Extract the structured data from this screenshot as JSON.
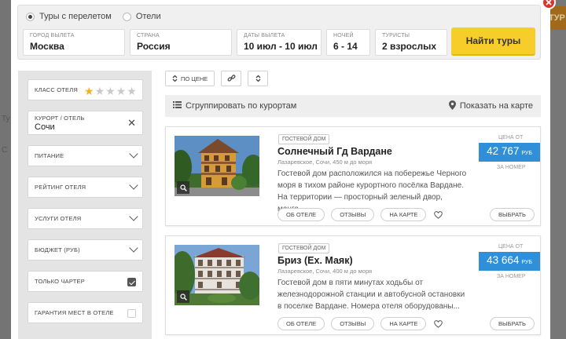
{
  "background": {
    "orange_tab": "ТУР",
    "left_glyphs": [
      "Ту",
      "С"
    ]
  },
  "search": {
    "tour_types": [
      {
        "label": "Туры с перелетом",
        "checked": true
      },
      {
        "label": "Отели",
        "checked": false
      }
    ],
    "fields": [
      {
        "label": "ГОРОД ВЫЛЕТА",
        "value": "Москва"
      },
      {
        "label": "СТРАНА",
        "value": "Россия"
      },
      {
        "label": "ДАТЫ ВЫЛЕТА",
        "value": "10 июл - 10 июл"
      },
      {
        "label": "НОЧЕЙ",
        "value": "6 - 14"
      },
      {
        "label": "ТУРИСТЫ",
        "value": "2 взрослых"
      }
    ],
    "find_button": "Найти туры"
  },
  "filters": {
    "hotel_class": {
      "label": "КЛАСС ОТЕЛЯ",
      "stars_selected": 1,
      "stars_total": 5
    },
    "resort": {
      "label": "КУРОРТ / ОТЕЛЬ",
      "value": "Сочи"
    },
    "dropdowns": [
      {
        "label": "ПИТАНИЕ"
      },
      {
        "label": "РЕЙТИНГ ОТЕЛЯ"
      },
      {
        "label": "УСЛУГИ ОТЕЛЯ"
      },
      {
        "label": "БЮДЖЕТ (РУБ)"
      }
    ],
    "checkboxes": [
      {
        "label": "ТОЛЬКО ЧАРТЕР",
        "checked": true
      },
      {
        "label": "ГАРАНТИЯ МЕСТ В ОТЕЛЕ",
        "checked": false
      }
    ]
  },
  "sort": {
    "by_price": "ПО ЦЕНЕ"
  },
  "group_bar": {
    "group_label": "Сгруппировать по курортам",
    "map_label": "Показать на карте"
  },
  "hotels": [
    {
      "category": "ГОСТЕВОЙ ДОМ",
      "name": "Солнечный Гд Вардане",
      "location": "Лазаревское, Сочи, 450 м до моря",
      "description": "Гостевой дом расположился на побережье Черного моря в тихом районе курортного посёлка Вардане. На территории — просторный зеленый двор, манга...",
      "price_label": "ЦЕНА ОТ",
      "price": "42 767",
      "currency": "РУБ",
      "per_room": "ЗА НОМЕР",
      "actions": [
        "ОБ ОТЕЛЕ",
        "ОТЗЫВЫ",
        "НА КАРТЕ"
      ],
      "choose": "ВЫБРАТЬ"
    },
    {
      "category": "ГОСТЕВОЙ ДОМ",
      "name": "Бриз (Ех. Маяк)",
      "location": "Лазаревское, Сочи, 400 м до моря",
      "description": "Гостевой дом в пяти минутах ходьбы от железнодорожной станции и автобусной остановки в поселке Вардане. Номера отеля оборудованы...",
      "price_label": "ЦЕНА ОТ",
      "price": "43 664",
      "currency": "РУБ",
      "per_room": "ЗА НОМЕР",
      "actions": [
        "ОБ ОТЕЛЕ",
        "ОТЗЫВЫ",
        "НА КАРТЕ"
      ],
      "choose": "ВЫБРАТЬ"
    }
  ],
  "colors": {
    "accent_yellow": "#f7cd2a",
    "price_blue": "#2f8fd8",
    "star_gold": "#f2b01e",
    "close_red": "#d9352b"
  }
}
